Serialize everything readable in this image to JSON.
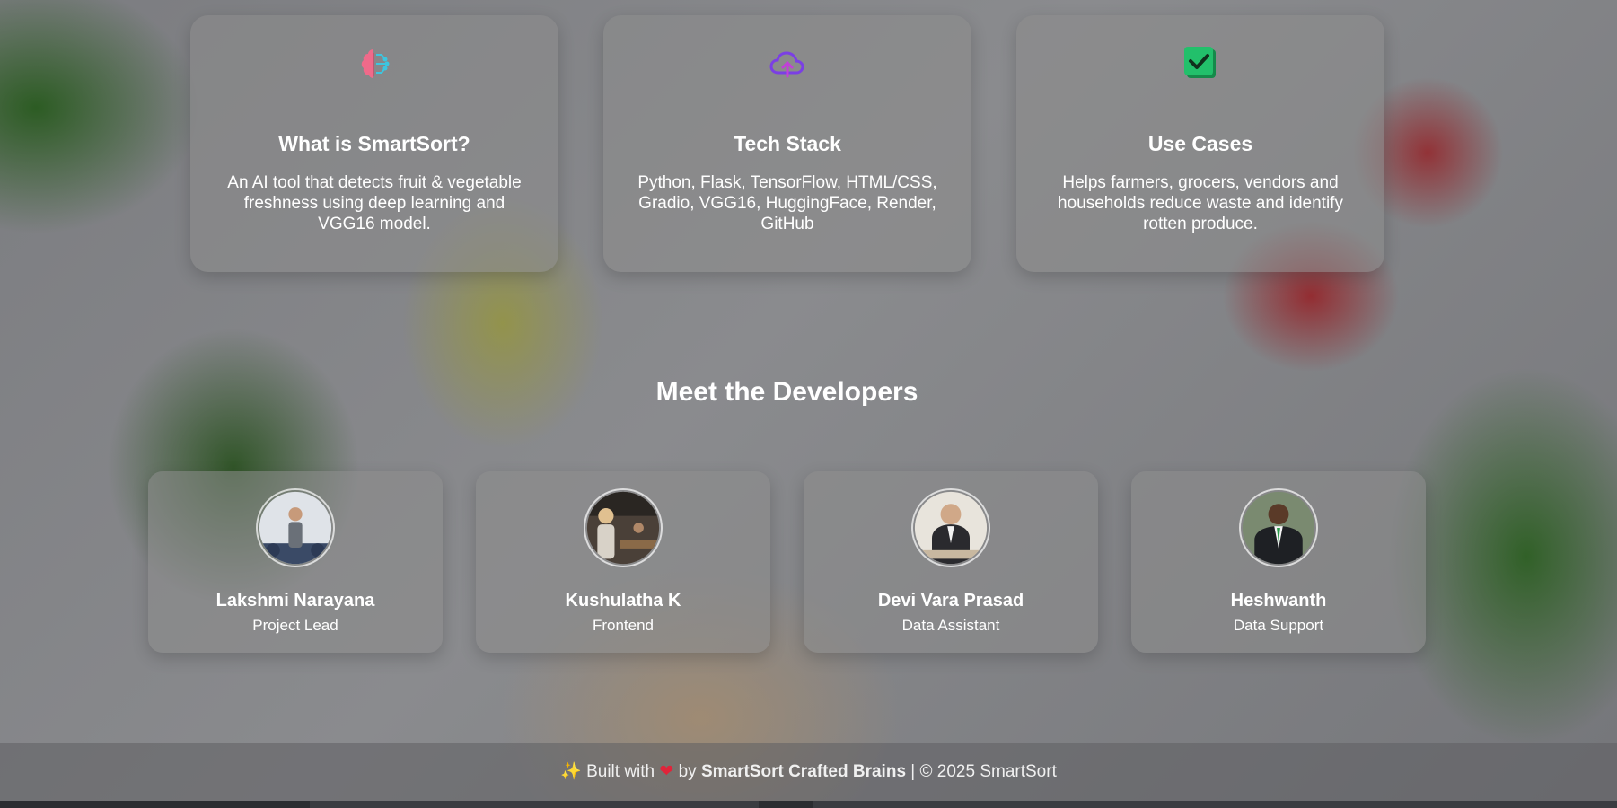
{
  "info_cards": [
    {
      "icon": "brain-circuit-icon",
      "title": "What is SmartSort?",
      "text": "An AI tool that detects fruit & vegetable freshness using deep learning and VGG16 model."
    },
    {
      "icon": "cloud-upload-icon",
      "title": "Tech Stack",
      "text": "Python, Flask, TensorFlow, HTML/CSS, Gradio, VGG16, HuggingFace, Render, GitHub"
    },
    {
      "icon": "check-box-icon",
      "title": "Use Cases",
      "text": "Helps farmers, grocers, vendors and households reduce waste and identify rotten produce."
    }
  ],
  "developers_section": {
    "title": "Meet the Developers",
    "developers": [
      {
        "name": "Lakshmi Narayana",
        "role": "Project Lead"
      },
      {
        "name": "Kushulatha K",
        "role": "Frontend"
      },
      {
        "name": "Devi Vara Prasad",
        "role": "Data Assistant"
      },
      {
        "name": "Heshwanth",
        "role": "Data Support"
      }
    ]
  },
  "footer": {
    "built_with": "Built with",
    "by": "by",
    "team": "SmartSort Crafted Brains",
    "separator": "|",
    "copyright": "© 2025 SmartSort"
  },
  "colors": {
    "accent_red": "#e0243a",
    "check_green": "#22c06b",
    "cloud_purple": "#7b3fe4",
    "brain_pink": "#f06a8a"
  }
}
